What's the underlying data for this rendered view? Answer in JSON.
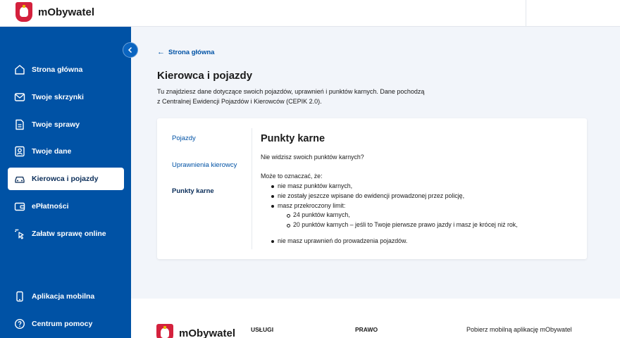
{
  "header": {
    "app_name": "mObywatel"
  },
  "sidebar": {
    "items": [
      {
        "label": "Strona główna"
      },
      {
        "label": "Twoje skrzynki"
      },
      {
        "label": "Twoje sprawy"
      },
      {
        "label": "Twoje dane"
      },
      {
        "label": "Kierowca i pojazdy"
      },
      {
        "label": "ePłatności"
      },
      {
        "label": "Załatw sprawę online"
      },
      {
        "label": "Aplikacja mobilna"
      },
      {
        "label": "Centrum pomocy"
      }
    ]
  },
  "main": {
    "back_link": "Strona główna",
    "title": "Kierowca i pojazdy",
    "intro_line1": "Tu znajdziesz dane dotyczące swoich pojazdów, uprawnień i punktów karnych. Dane pochodzą",
    "intro_line2": "z Centralnej Ewidencji Pojazdów i Kierowców (CEPIK 2.0).",
    "tabs": [
      {
        "label": "Pojazdy"
      },
      {
        "label": "Uprawnienia kierowcy"
      },
      {
        "label": "Punkty karne"
      }
    ],
    "content": {
      "heading": "Punkty karne",
      "question": "Nie widzisz swoich punktów karnych?",
      "lead": "Może to oznaczać, że:",
      "bullets": [
        "nie masz punktów karnych,",
        "nie zostały jeszcze wpisane do ewidencji prowadzonej przez policję,",
        "masz przekroczony limit:"
      ],
      "sub_bullets": [
        "24 punktów karnych,",
        "20 punktów karnych – jeśli to Twoje pierwsze prawo jazdy i masz je krócej niż rok,"
      ],
      "last_bullet": "nie masz uprawnień do prowadzenia pojazdów."
    }
  },
  "footer": {
    "app_name": "mObywatel",
    "col1": "USŁUGI",
    "col2": "PRAWO",
    "app_text": "Pobierz mobilną aplikację mObywatel"
  }
}
